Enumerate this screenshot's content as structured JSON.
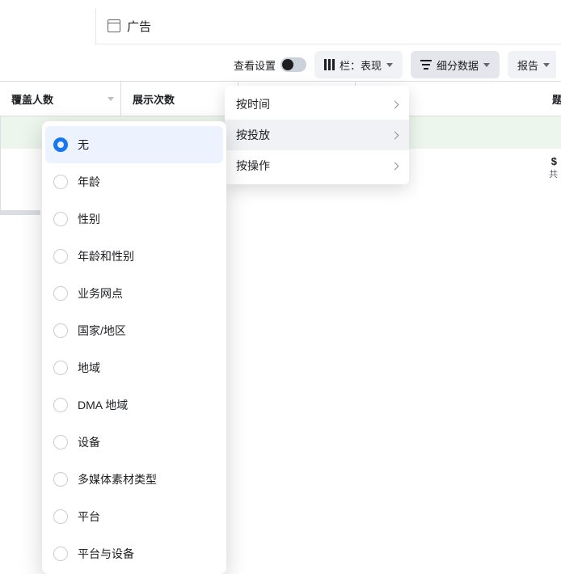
{
  "tab": {
    "label": "广告"
  },
  "toolbar": {
    "view_settings": "查看设置",
    "columns_label": "栏：表现",
    "breakdown_label": "细分数据",
    "report_label": "报告"
  },
  "columns": {
    "col1": "覆盖人数",
    "col2": "展示次数",
    "col3": "",
    "col4_partial": "题"
  },
  "summary": {
    "value": "$",
    "sub": "共"
  },
  "menu": {
    "by_time": "按时间",
    "by_delivery": "按投放",
    "by_action": "按操作"
  },
  "breakdown_options": [
    "无",
    "年龄",
    "性别",
    "年龄和性别",
    "业务网点",
    "国家/地区",
    "地域",
    "DMA 地域",
    "设备",
    "多媒体素材类型",
    "平台",
    "平台与设备"
  ]
}
